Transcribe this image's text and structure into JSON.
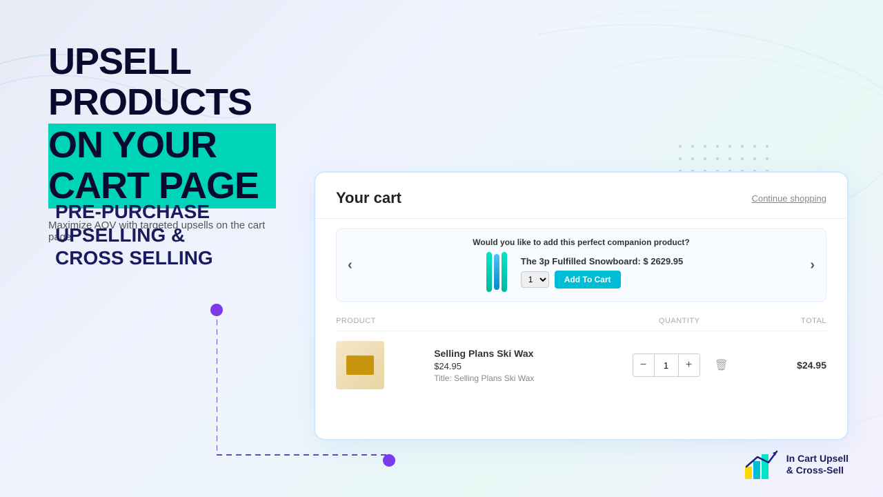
{
  "page": {
    "background": "#eef0f8"
  },
  "header": {
    "main_title_line1": "UPSELL PRODUCTS",
    "main_title_line2": "ON YOUR CART PAGE",
    "subtitle": "Maximize AOV with targeted upsells on the cart page"
  },
  "sidebar": {
    "pre_purchase_line1": "PRE-PURCHASE",
    "pre_purchase_line2": "UPSELLING &",
    "pre_purchase_line3": "CROSS SELLING"
  },
  "cart_ui": {
    "title": "Your cart",
    "continue_shopping": "Continue shopping",
    "upsell_question": "Would you like to add this perfect companion product?",
    "upsell_product_name": "The 3p Fulfilled Snowboard: $ 2629.95",
    "upsell_qty": "1",
    "add_to_cart_btn": "Add To Cart",
    "table_headers": {
      "product": "PRODUCT",
      "quantity": "QUANTITY",
      "total": "TOTAL"
    },
    "cart_item": {
      "name": "Selling Plans Ski Wax",
      "price": "$24.95",
      "variant": "Title: Selling Plans Ski Wax",
      "qty": "1",
      "total": "$24.95"
    }
  },
  "logo": {
    "line1": "In Cart Upsell",
    "line2": "& Cross-Sell"
  },
  "colors": {
    "accent_teal": "#00d4b8",
    "accent_blue": "#00bcd4",
    "dark_navy": "#1a1a5e",
    "purple_dot": "#7c3aed"
  }
}
